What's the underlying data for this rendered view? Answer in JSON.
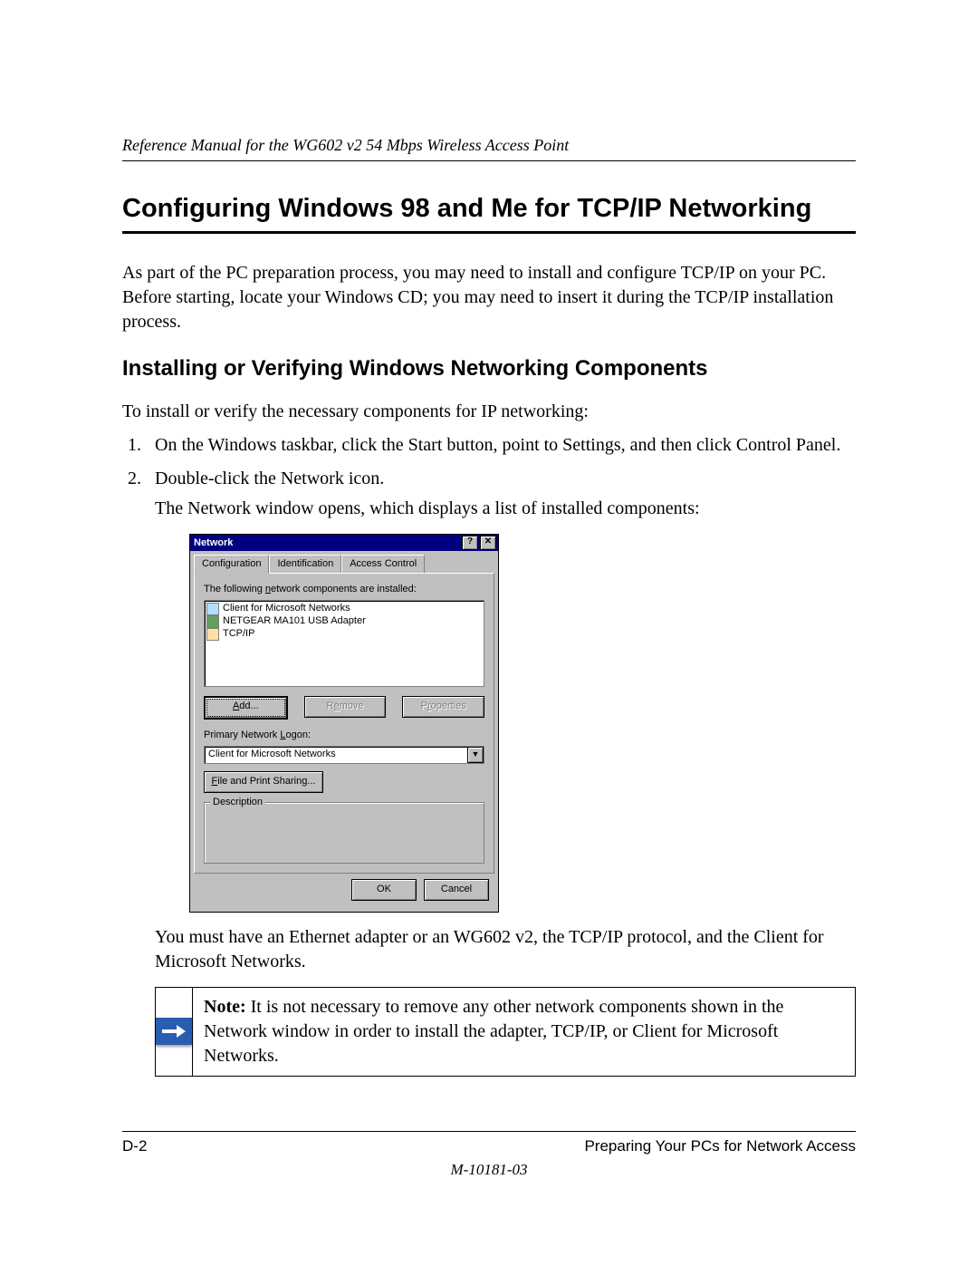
{
  "header": {
    "running_head": "Reference Manual for the WG602 v2 54 Mbps Wireless Access Point"
  },
  "section": {
    "title": "Configuring Windows 98 and Me for TCP/IP Networking",
    "intro": "As part of the PC preparation process, you may need to install and configure TCP/IP on your PC. Before starting, locate your Windows CD; you may need to insert it during the TCP/IP installation process."
  },
  "subsection": {
    "title": "Installing or Verifying Windows Networking Components",
    "lead_in": "To install or verify the necessary components for IP networking:",
    "steps": [
      "On the Windows taskbar, click the Start button, point to Settings, and then click Control Panel.",
      "Double-click the Network icon."
    ],
    "step2_follow": "The Network window opens, which displays a list of installed components:",
    "after_image": "You must have an Ethernet adapter or an WG602 v2, the TCP/IP protocol, and the Client for Microsoft Networks."
  },
  "dialog": {
    "title": "Network",
    "help_btn": "?",
    "close_btn": "✕",
    "tabs": [
      "Configuration",
      "Identification",
      "Access Control"
    ],
    "active_tab": 0,
    "list_label": "The following network components are installed:",
    "components": [
      "Client for Microsoft Networks",
      "NETGEAR MA101 USB Adapter",
      "TCP/IP"
    ],
    "buttons": {
      "add": "Add...",
      "remove": "Remove",
      "properties": "Properties"
    },
    "logon_label": "Primary Network Logon:",
    "logon_value": "Client for Microsoft Networks",
    "file_share_btn": "File and Print Sharing...",
    "group_label": "Description",
    "ok": "OK",
    "cancel": "Cancel"
  },
  "note": {
    "label": "Note:",
    "text": " It is not necessary to remove any other network components shown in the Network window in order to install the adapter, TCP/IP, or Client for Microsoft Networks."
  },
  "footer": {
    "page_num": "D-2",
    "section_name": "Preparing Your PCs for Network Access",
    "doc_code": "M-10181-03"
  }
}
